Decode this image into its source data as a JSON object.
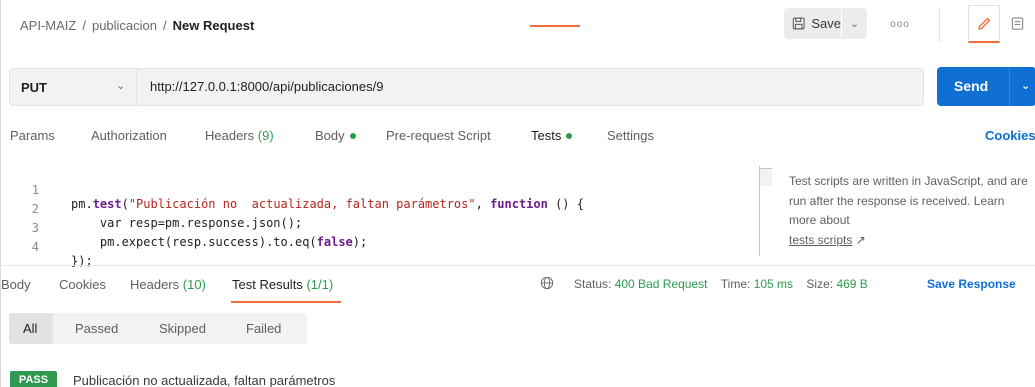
{
  "breadcrumb": {
    "collection": "API-MAIZ",
    "folder": "publicacion",
    "request": "New Request",
    "separator": "/"
  },
  "toolbar": {
    "save_label": "Save",
    "save_icon": "floppy-icon",
    "more_label": "ooo",
    "edit_icon": "pencil-icon",
    "doc_icon": "document-icon"
  },
  "request": {
    "method": "PUT",
    "url": "http://127.0.0.1:8000/api/publicaciones/9",
    "send_label": "Send"
  },
  "request_tabs": [
    {
      "label": "Params"
    },
    {
      "label": "Authorization"
    },
    {
      "label": "Headers",
      "count": "(9)"
    },
    {
      "label": "Body",
      "dot": true
    },
    {
      "label": "Pre-request Script"
    },
    {
      "label": "Tests",
      "dot": true,
      "active": true
    },
    {
      "label": "Settings"
    }
  ],
  "cookies_link": "Cookies",
  "editor": {
    "line_numbers": [
      "1",
      "2",
      "3",
      "4"
    ],
    "lines": [
      [
        "pm.",
        "test",
        "(",
        "\"Publicación no  actualizada, faltan parámetros\"",
        ", ",
        "function",
        " () {"
      ],
      [
        "    var resp=pm.response.json();"
      ],
      [
        "    pm.expect(resp.success).to.eq(",
        "false",
        ");"
      ],
      [
        "});"
      ]
    ]
  },
  "help": {
    "text": "Test scripts are written in JavaScript, and are run after the response is received. Learn more about",
    "link": "tests scripts",
    "link_arrow": "↗"
  },
  "response_tabs": [
    {
      "label": "Body"
    },
    {
      "label": "Cookies"
    },
    {
      "label": "Headers",
      "count": "(10)"
    },
    {
      "label": "Test Results",
      "count": "(1/1)",
      "active": true
    }
  ],
  "response_status": {
    "status_label": "Status:",
    "status_value": "400 Bad Request",
    "time_label": "Time:",
    "time_value": "105 ms",
    "size_label": "Size:",
    "size_value": "469 B",
    "save_response": "Save Response"
  },
  "filters": [
    "All",
    "Passed",
    "Skipped",
    "Failed"
  ],
  "results": [
    {
      "badge": "PASS",
      "name": "Publicación no actualizada, faltan parámetros"
    }
  ],
  "colors": {
    "accent": "#f26b3a",
    "primary": "#0f6fd3",
    "success": "#2f9a4f"
  }
}
